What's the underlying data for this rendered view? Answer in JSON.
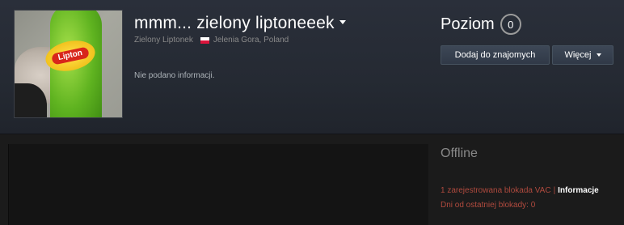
{
  "profile": {
    "persona_name": "mmm... zielony liptoneeek",
    "real_name": "Zielony Liptonek",
    "location": "Jelenia Gora, Poland",
    "summary": "Nie podano informacji.",
    "avatar_label": "Lipton"
  },
  "level": {
    "label": "Poziom",
    "value": "0"
  },
  "buttons": {
    "add_friend": "Dodaj do znajomych",
    "more": "Więcej"
  },
  "status": {
    "text": "Offline"
  },
  "bans": {
    "vac_text": "1 zarejestrowana blokada VAC",
    "separator": "|",
    "info_link": "Informacje",
    "days_text": "Dni od ostatniej blokady: 0"
  },
  "colors": {
    "header_bg": "#2a2f3a",
    "body_bg": "#1b1b1b",
    "ban_red": "#b04a3e",
    "button_bg": "#3d4756"
  },
  "icons": {
    "name_dropdown": "caret-down-icon",
    "country_flag": "poland-flag-icon",
    "more_dropdown": "caret-down-icon"
  }
}
